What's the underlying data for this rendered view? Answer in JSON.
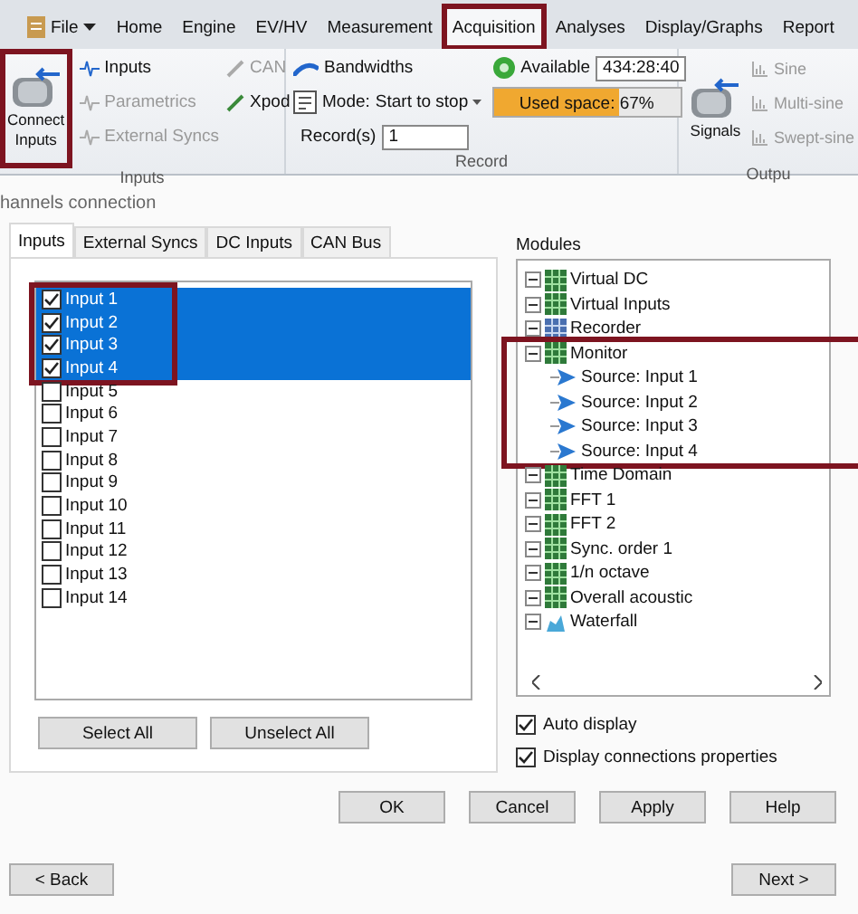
{
  "menu_tabs": [
    {
      "label": "File",
      "kind": "file",
      "selected": false,
      "highlighted": false
    },
    {
      "label": "Home",
      "kind": "tab",
      "selected": false,
      "highlighted": false
    },
    {
      "label": "Engine",
      "kind": "tab",
      "selected": false,
      "highlighted": false
    },
    {
      "label": "EV/HV",
      "kind": "tab",
      "selected": false,
      "highlighted": false
    },
    {
      "label": "Measurement",
      "kind": "tab",
      "selected": false,
      "highlighted": false
    },
    {
      "label": "Acquisition",
      "kind": "tab",
      "selected": true,
      "highlighted": true
    },
    {
      "label": "Analyses",
      "kind": "tab",
      "selected": false,
      "highlighted": false
    },
    {
      "label": "Display/Graphs",
      "kind": "tab",
      "selected": false,
      "highlighted": false
    },
    {
      "label": "Report",
      "kind": "tab",
      "selected": false,
      "highlighted": false
    }
  ],
  "ribbon": {
    "inputs_group": {
      "title": "Inputs",
      "connect_button": {
        "label": "Connect Inputs",
        "highlighted": true
      },
      "items": [
        {
          "label": "Inputs",
          "disabled": false
        },
        {
          "label": "Parametrics",
          "disabled": true
        },
        {
          "label": "External Syncs",
          "disabled": true
        }
      ],
      "side_items": [
        {
          "label": "CAN",
          "disabled": true
        },
        {
          "label": "Xpod",
          "disabled": false
        }
      ]
    },
    "record_group": {
      "title": "Record",
      "bandwidths": "Bandwidths",
      "mode_label": "Mode:",
      "mode_value": "Start to stop",
      "records_label": "Record(s)",
      "records_value": "1",
      "available_label": "Available",
      "available_value": "434:28:40",
      "used_space": {
        "label": "Used space: 67%",
        "level": 0.67
      }
    },
    "outputs_group": {
      "title": "Outpu",
      "signals": "Signals",
      "items": [
        {
          "label": "Sine",
          "disabled": true
        },
        {
          "label": "Multi-sine",
          "disabled": true
        },
        {
          "label": "Swept-sine",
          "disabled": true
        }
      ]
    }
  },
  "dialog": {
    "title": "hannels connection",
    "tabs": [
      {
        "label": "Inputs",
        "selected": true
      },
      {
        "label": "External Syncs",
        "selected": false
      },
      {
        "label": "DC Inputs",
        "selected": false
      },
      {
        "label": "CAN Bus",
        "selected": false
      }
    ],
    "inputs": [
      {
        "label": "Input 1",
        "checked": true,
        "selected": true,
        "highlighted": true
      },
      {
        "label": "Input 2",
        "checked": true,
        "selected": true,
        "highlighted": true
      },
      {
        "label": "Input 3",
        "checked": true,
        "selected": true,
        "highlighted": true
      },
      {
        "label": "Input 4",
        "checked": true,
        "selected": true,
        "highlighted": true
      },
      {
        "label": "Input 5",
        "checked": false,
        "selected": false,
        "highlighted": false
      },
      {
        "label": "Input 6",
        "checked": false,
        "selected": false,
        "highlighted": false
      },
      {
        "label": "Input 7",
        "checked": false,
        "selected": false,
        "highlighted": false
      },
      {
        "label": "Input 8",
        "checked": false,
        "selected": false,
        "highlighted": false
      },
      {
        "label": "Input 9",
        "checked": false,
        "selected": false,
        "highlighted": false
      },
      {
        "label": "Input 10",
        "checked": false,
        "selected": false,
        "highlighted": false
      },
      {
        "label": "Input 11",
        "checked": false,
        "selected": false,
        "highlighted": false
      },
      {
        "label": "Input 12",
        "checked": false,
        "selected": false,
        "highlighted": false
      },
      {
        "label": "Input 13",
        "checked": false,
        "selected": false,
        "highlighted": false
      },
      {
        "label": "Input 14",
        "checked": false,
        "selected": false,
        "highlighted": false
      }
    ],
    "list_buttons": [
      "Select All",
      "Unselect All"
    ],
    "modules_title": "Modules",
    "modules": [
      {
        "label": "Virtual DC",
        "kind": "module",
        "expanded": true,
        "highlighted": false
      },
      {
        "label": "Virtual Inputs",
        "kind": "module",
        "expanded": true,
        "highlighted": false
      },
      {
        "label": "Recorder",
        "kind": "recorder",
        "expanded": true,
        "highlighted": false
      },
      {
        "label": "Monitor",
        "kind": "module",
        "expanded": true,
        "highlighted": true,
        "children": [
          {
            "label": "Source: Input 1",
            "kind": "source"
          },
          {
            "label": "Source: Input 2",
            "kind": "source"
          },
          {
            "label": "Source: Input 3",
            "kind": "source"
          },
          {
            "label": "Source: Input 4",
            "kind": "source"
          }
        ]
      },
      {
        "label": "Time Domain",
        "kind": "module",
        "expanded": true,
        "highlighted": false
      },
      {
        "label": "FFT 1",
        "kind": "module",
        "expanded": true,
        "highlighted": false
      },
      {
        "label": "FFT 2",
        "kind": "module",
        "expanded": true,
        "highlighted": false
      },
      {
        "label": "Sync. order 1",
        "kind": "module",
        "expanded": true,
        "highlighted": false
      },
      {
        "label": "1/n octave",
        "kind": "module",
        "expanded": true,
        "highlighted": false
      },
      {
        "label": "Overall acoustic",
        "kind": "module",
        "expanded": true,
        "highlighted": false
      },
      {
        "label": "Waterfall",
        "kind": "waterfall",
        "expanded": true,
        "highlighted": false
      }
    ],
    "options": [
      {
        "label": "Auto display",
        "checked": true
      },
      {
        "label": "Display connections properties",
        "checked": true
      }
    ],
    "buttons": [
      "OK",
      "Cancel",
      "Apply",
      "Help"
    ],
    "nav": {
      "back": "< Back",
      "next": "Next >"
    }
  }
}
